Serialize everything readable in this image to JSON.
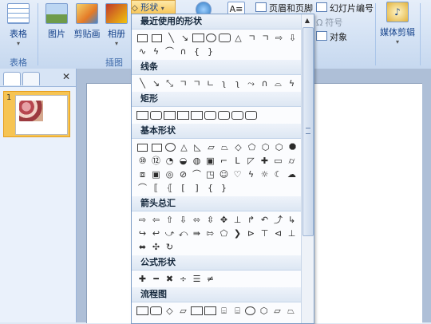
{
  "ribbon": {
    "table_label": "表格",
    "picture_label": "图片",
    "clipart_label": "剪贴画",
    "album_label": "相册",
    "shapes_label": "形状",
    "header_footer_label": "页眉和页脚",
    "slide_number_label": "幻灯片编号",
    "symbol_label": "符号",
    "object_label": "对象",
    "media_clip_label": "媒体剪辑",
    "group_tables": "表格",
    "group_illustrations": "插图"
  },
  "gallery": {
    "recent": "最近使用的形状",
    "lines": "线条",
    "rectangles": "矩形",
    "basic": "基本形状",
    "arrows": "箭头总汇",
    "equation": "公式形状",
    "flowchart": "流程图"
  },
  "slides_pane": {
    "slide_number": "1"
  },
  "colors": {
    "selected_thumb": "#f6c453",
    "ribbon_text": "#15428b"
  }
}
